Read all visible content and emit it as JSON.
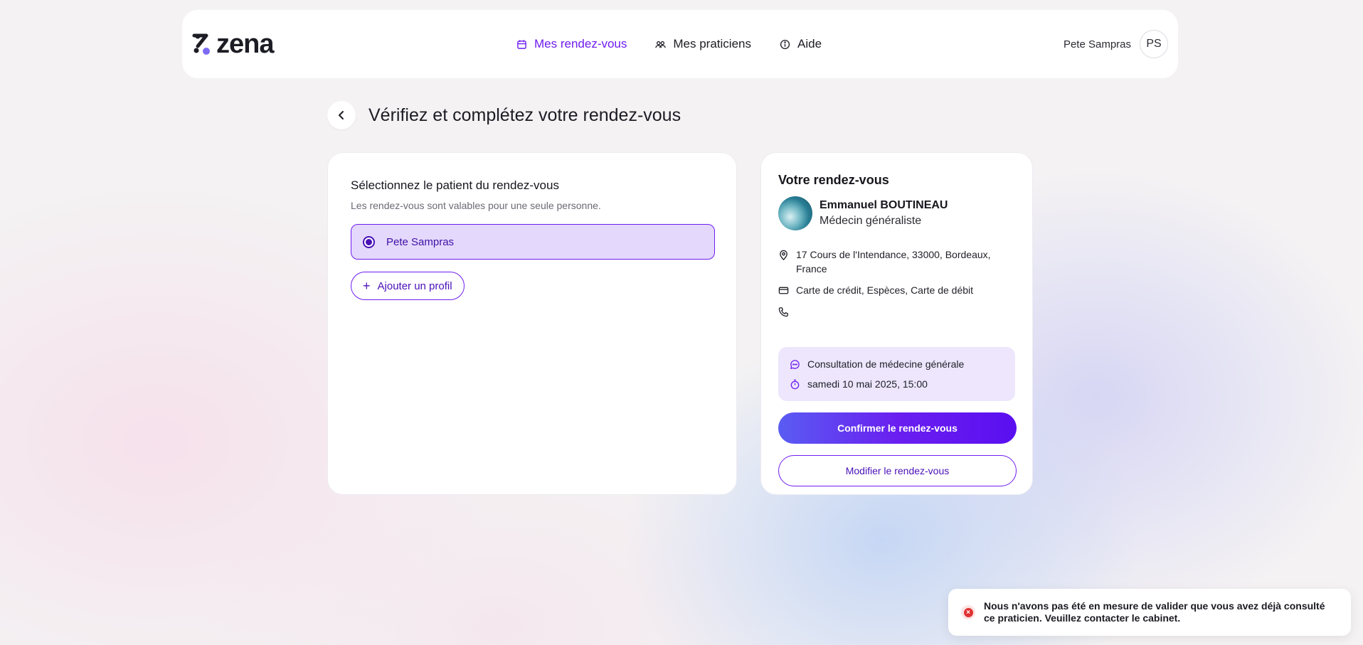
{
  "brand": {
    "name": "zena"
  },
  "nav": {
    "items": [
      {
        "label": "Mes rendez-vous",
        "icon": "calendar-icon",
        "active": true
      },
      {
        "label": "Mes praticiens",
        "icon": "people-icon",
        "active": false
      },
      {
        "label": "Aide",
        "icon": "info-icon",
        "active": false
      }
    ]
  },
  "user": {
    "name": "Pete Sampras",
    "initials": "PS"
  },
  "page": {
    "title": "Vérifiez et complétez votre rendez-vous"
  },
  "patient_section": {
    "title": "Sélectionnez le patient du rendez-vous",
    "subtitle": "Les rendez-vous sont valables pour une seule personne.",
    "selected_patient": "Pete Sampras",
    "add_profile_label": "Ajouter un profil"
  },
  "appointment": {
    "title": "Votre rendez-vous",
    "doctor_name": "Emmanuel BOUTINEAU",
    "doctor_specialty": "Médecin généraliste",
    "address": "17 Cours de l'Intendance, 33000, Bordeaux, France",
    "payment_methods": "Carte de crédit, Espèces, Carte de débit",
    "phone": "",
    "consultation_type": "Consultation de médecine générale",
    "datetime": "samedi 10 mai 2025, 15:00",
    "confirm_label": "Confirmer le rendez-vous",
    "modify_label": "Modifier le rendez-vous"
  },
  "toast": {
    "message": "Nous n'avons pas été en mesure de valider que vous avez déjà consulté ce praticien. Veuillez contacter le cabinet."
  },
  "colors": {
    "accent": "#6f1cf0",
    "accent_light": "#e4d8fc",
    "error": "#e03131"
  }
}
